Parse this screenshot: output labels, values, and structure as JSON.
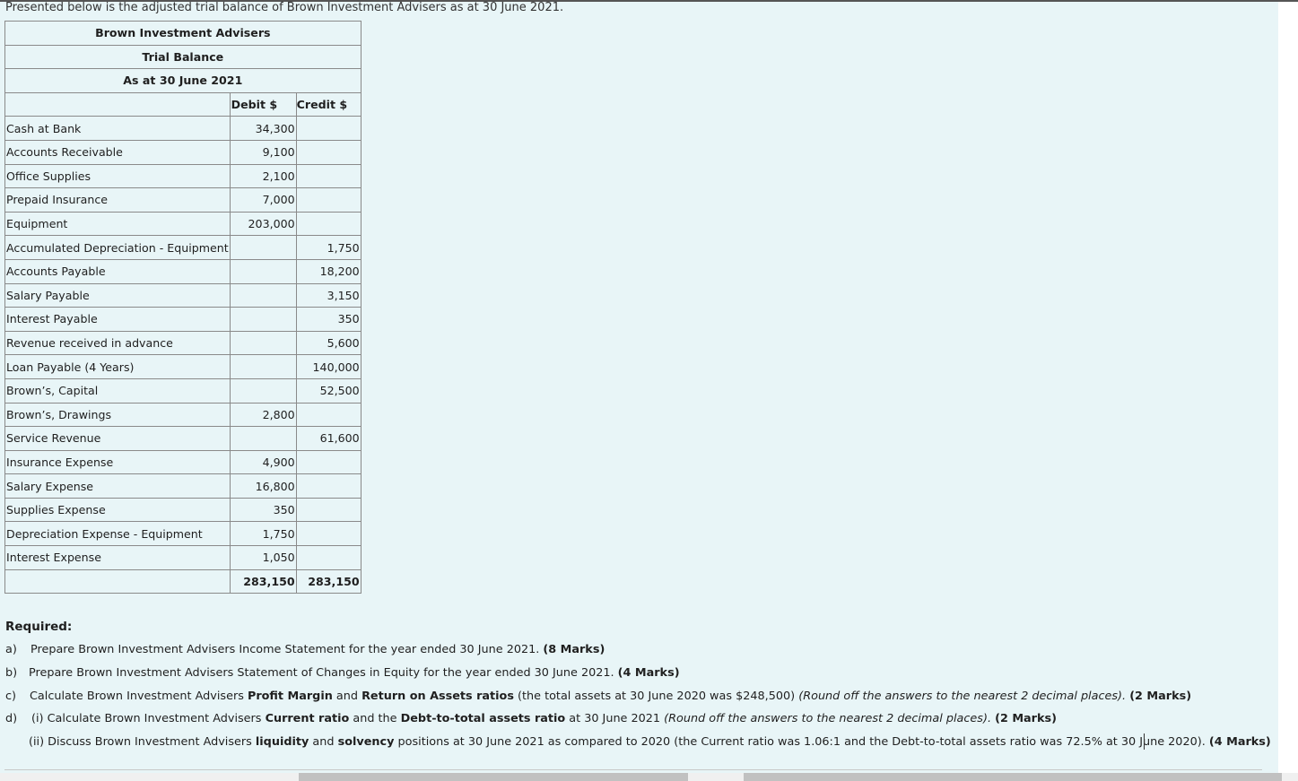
{
  "intro": "Presented below is the adjusted trial balance of Brown Investment Advisers as at 30 June 2021.",
  "table": {
    "company": "Brown Investment Advisers",
    "title": "Trial Balance",
    "date": "As at 30 June 2021",
    "debit_header": "Debit $",
    "credit_header": "Credit $",
    "rows": [
      {
        "account": "Cash at Bank",
        "debit": "34,300",
        "credit": ""
      },
      {
        "account": "Accounts Receivable",
        "debit": "9,100",
        "credit": ""
      },
      {
        "account": "Office Supplies",
        "debit": "2,100",
        "credit": ""
      },
      {
        "account": "Prepaid Insurance",
        "debit": "7,000",
        "credit": ""
      },
      {
        "account": "Equipment",
        "debit": "203,000",
        "credit": ""
      },
      {
        "account": "Accumulated Depreciation - Equipment",
        "debit": "",
        "credit": "1,750"
      },
      {
        "account": "Accounts Payable",
        "debit": "",
        "credit": "18,200"
      },
      {
        "account": "Salary Payable",
        "debit": "",
        "credit": "3,150"
      },
      {
        "account": "Interest Payable",
        "debit": "",
        "credit": "350"
      },
      {
        "account": "Revenue received in advance",
        "debit": "",
        "credit": "5,600"
      },
      {
        "account": "Loan Payable (4 Years)",
        "debit": "",
        "credit": "140,000"
      },
      {
        "account": "Brown’s, Capital",
        "debit": "",
        "credit": "52,500"
      },
      {
        "account": "Brown’s, Drawings",
        "debit": "2,800",
        "credit": ""
      },
      {
        "account": "Service Revenue",
        "debit": "",
        "credit": "61,600"
      },
      {
        "account": "Insurance Expense",
        "debit": "4,900",
        "credit": ""
      },
      {
        "account": "Salary Expense",
        "debit": "16,800",
        "credit": ""
      },
      {
        "account": "Supplies Expense",
        "debit": "350",
        "credit": ""
      },
      {
        "account": "Depreciation Expense - Equipment",
        "debit": "1,750",
        "credit": ""
      },
      {
        "account": "Interest Expense",
        "debit": "1,050",
        "credit": ""
      }
    ],
    "total_debit": "283,150",
    "total_credit": "283,150"
  },
  "required": {
    "heading": "Required:",
    "a_label": "a)",
    "a_text": "Prepare Brown Investment Advisers Income Statement for the year ended 30 June 2021.",
    "a_marks": "(8 Marks)",
    "b_label": "b)",
    "b_text": "Prepare Brown Investment Advisers Statement of Changes in Equity for the year ended 30 June 2021.",
    "b_marks": "(4 Marks)",
    "c_label": "c)",
    "c_pre": "Calculate Brown Investment Advisers",
    "c_b1": "Profit Margin",
    "c_mid": "and",
    "c_b2": "Return on Assets ratios",
    "c_post": "(the total assets at 30 June 2020 was $248,500)",
    "c_italic": "(Round off the answers to the nearest 2 decimal places).",
    "c_marks": "(2 Marks)",
    "d_label": "d)",
    "d_pre": "(i) Calculate Brown Investment Advisers",
    "d_b1": "Current ratio",
    "d_mid": "and the",
    "d_b2": "Debt-to-total assets ratio",
    "d_post": "at 30 June 2021",
    "d_italic": "(Round off the answers to the nearest 2 decimal places).",
    "d_marks": "(2 Marks)",
    "e_pre": "(ii) Discuss Brown Investment Advisers",
    "e_b1": "liquidity",
    "e_mid": "and",
    "e_b2": "solvency",
    "e_post": "positions at 30 June 2021 as compared to 2020 (the Current ratio was 1.06:1 and the Debt-to-total assets ratio was 72.5% at 30 June 2020).",
    "e_marks": "(4 Marks)"
  }
}
